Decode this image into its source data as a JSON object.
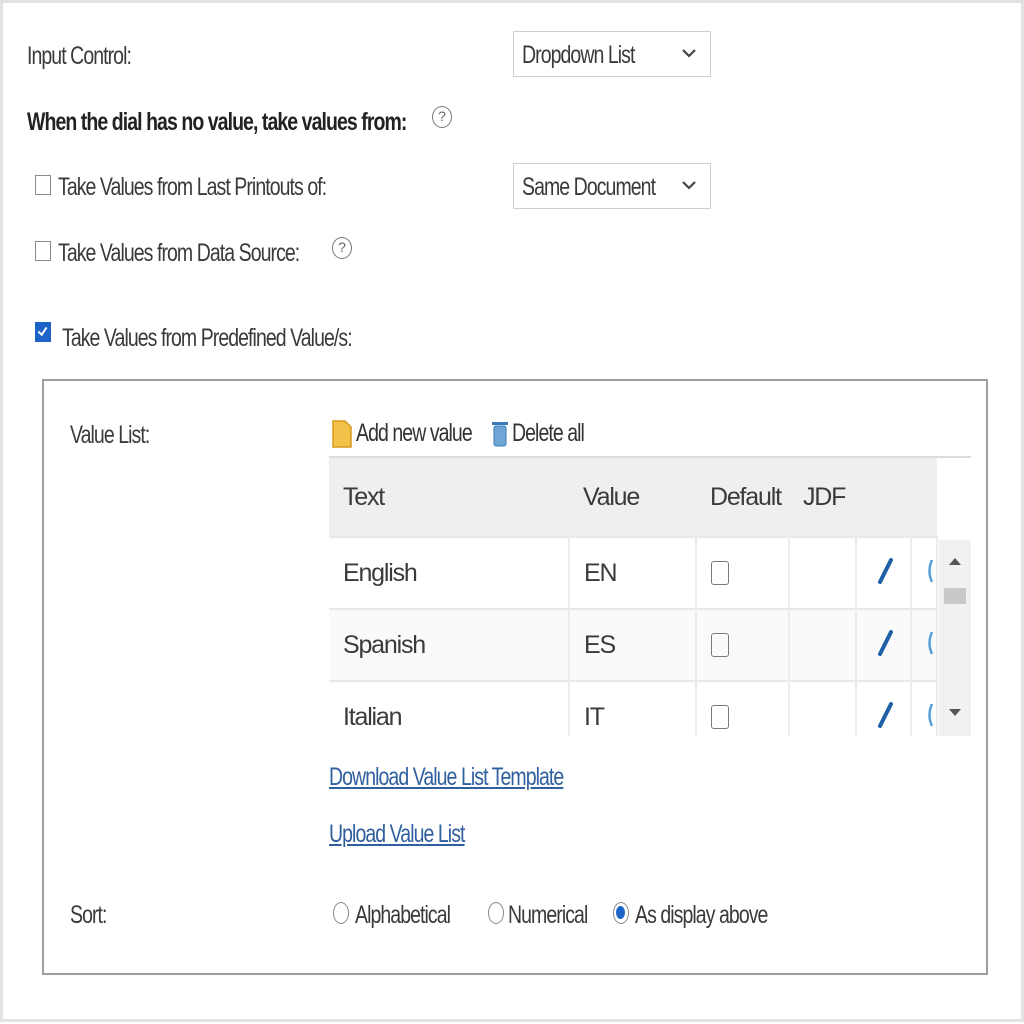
{
  "input_control": {
    "label": "Input Control:",
    "selected": "Dropdown List"
  },
  "source_heading": "When the dial has no value, take values from:",
  "help_glyph": "?",
  "options": {
    "last_printouts": {
      "label": "Take Values from Last Printouts of:",
      "checked": false,
      "selected": "Same Document"
    },
    "data_source": {
      "label": "Take Values from Data Source:",
      "checked": false
    },
    "predefined": {
      "label": "Take Values from Predefined Value/s:",
      "checked": true
    }
  },
  "value_list": {
    "label": "Value List:",
    "add_label": "Add new value",
    "delete_label": "Delete all",
    "columns": [
      "Text",
      "Value",
      "Default",
      "JDF"
    ],
    "rows": [
      {
        "text": "English",
        "value": "EN",
        "default": false
      },
      {
        "text": "Spanish",
        "value": "ES",
        "default": false
      },
      {
        "text": "Italian",
        "value": "IT",
        "default": false
      }
    ],
    "download_link": "Download Value List Template",
    "upload_link": "Upload Value List"
  },
  "sort": {
    "label": "Sort:",
    "options": [
      "Alphabetical",
      "Numerical",
      "As display above"
    ],
    "selected_index": 2
  },
  "colors": {
    "accent": "#1e64c8",
    "link": "#2f5f9e",
    "pencil": "#1f5fa6"
  }
}
